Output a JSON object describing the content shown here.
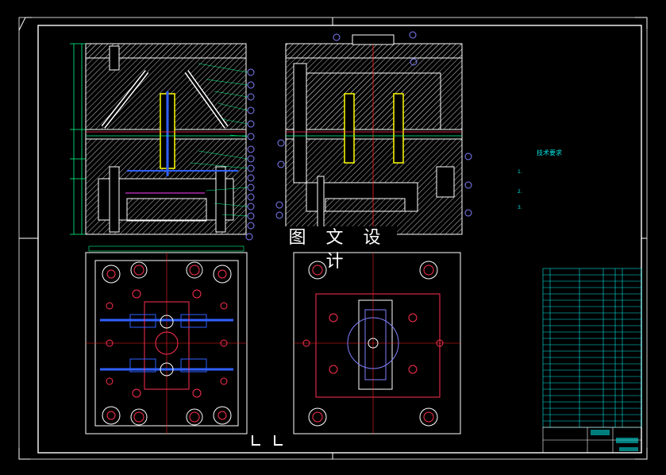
{
  "watermark": "图 文 设 计",
  "notes": {
    "title": "技术要求",
    "lines": [
      "1.",
      "2.",
      "3."
    ]
  },
  "colors": {
    "frame": "#ffffff",
    "hatch": "#c8c8c8",
    "callout": "#8080ff",
    "dimension": "#00ff88",
    "cooling": "#3060ff",
    "ejector": "#ff3050",
    "part": "#ffff00",
    "centerline": "#ff2020",
    "table": "#00e5e5",
    "title_block": "#00ffff"
  }
}
